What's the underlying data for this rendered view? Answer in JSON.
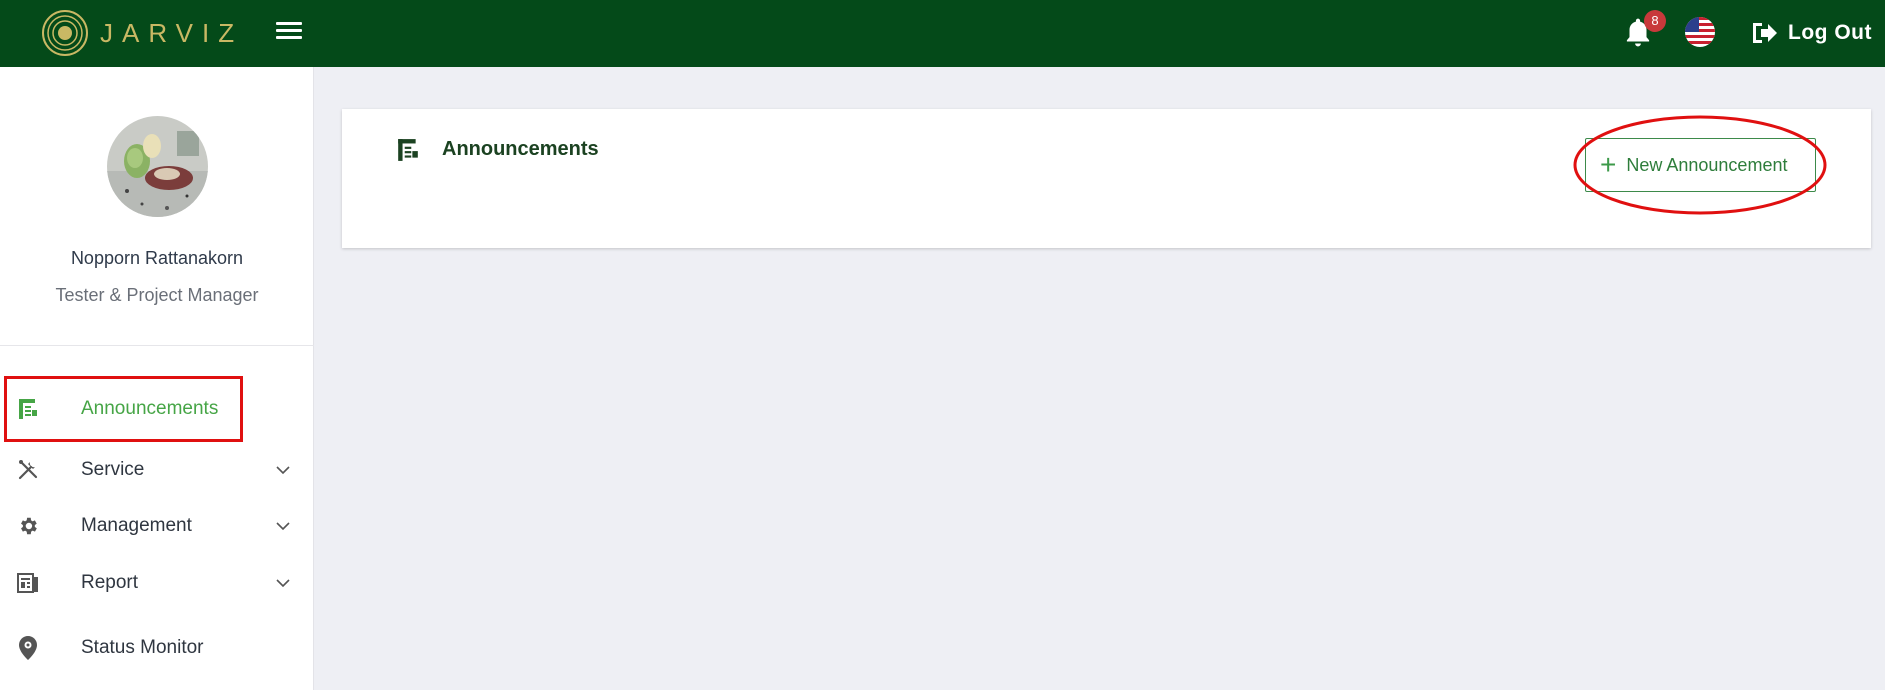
{
  "topbar": {
    "brand_name": "JARVIZ",
    "notification_count": "8",
    "logout_label": "Log Out",
    "colors": {
      "background": "#044a19",
      "brand_gold": "#c9b864"
    }
  },
  "profile": {
    "name": "Nopporn Rattanakorn",
    "role": "Tester & Project Manager"
  },
  "sidebar": {
    "items": [
      {
        "label": "Announcements",
        "icon": "announcement-icon",
        "active": true,
        "expandable": false
      },
      {
        "label": "Service",
        "icon": "tools-icon",
        "active": false,
        "expandable": true
      },
      {
        "label": "Management",
        "icon": "gear-icon",
        "active": false,
        "expandable": true
      },
      {
        "label": "Report",
        "icon": "report-icon",
        "active": false,
        "expandable": true
      },
      {
        "label": "Status Monitor",
        "icon": "location-pin-icon",
        "active": false,
        "expandable": false
      }
    ]
  },
  "main": {
    "title": "Announcements",
    "new_button_label": "New Announcement"
  },
  "annotations": {
    "highlight_color": "#e01010"
  }
}
